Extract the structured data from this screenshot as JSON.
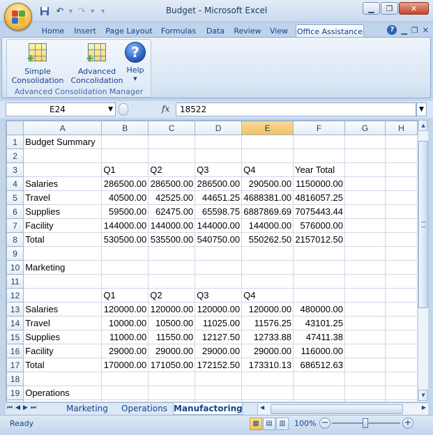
{
  "window": {
    "title": "Budget - Microsoft Excel"
  },
  "ribbon": {
    "tabs": [
      "Home",
      "Insert",
      "Page Layout",
      "Formulas",
      "Data",
      "Review",
      "View",
      "Office Assistance"
    ],
    "active_tab": "Office Assistance",
    "group": {
      "label": "Advanced Consolidation Manager",
      "buttons": [
        {
          "label1": "Simple",
          "label2": "Consolidation"
        },
        {
          "label1": "Advanced",
          "label2": "Concolidation"
        },
        {
          "label1": "Help",
          "label2": ""
        }
      ]
    }
  },
  "formula_bar": {
    "name_box": "E24",
    "fx": "fx",
    "value": "18522"
  },
  "sheet": {
    "columns": [
      "A",
      "B",
      "C",
      "D",
      "E",
      "F",
      "G",
      "H"
    ],
    "selected_column": "E",
    "rows": [
      [
        "Budget Summary",
        "",
        "",
        "",
        "",
        "",
        "",
        ""
      ],
      [
        "",
        "",
        "",
        "",
        "",
        "",
        "",
        ""
      ],
      [
        "",
        "Q1",
        "Q2",
        "Q3",
        "Q4",
        "Year Total",
        "",
        ""
      ],
      [
        "Salaries",
        "286500.00",
        "286500.00",
        "286500.00",
        "290500.00",
        "1150000.00",
        "",
        ""
      ],
      [
        "Travel",
        "40500.00",
        "42525.00",
        "44651.25",
        "4688381.00",
        "4816057.25",
        "",
        ""
      ],
      [
        "Supplies",
        "59500.00",
        "62475.00",
        "65598.75",
        "6887869.69",
        "7075443.44",
        "",
        ""
      ],
      [
        "Facility",
        "144000.00",
        "144000.00",
        "144000.00",
        "144000.00",
        "576000.00",
        "",
        ""
      ],
      [
        "Total",
        "530500.00",
        "535500.00",
        "540750.00",
        "550262.50",
        "2157012.50",
        "",
        ""
      ],
      [
        "",
        "",
        "",
        "",
        "",
        "",
        "",
        ""
      ],
      [
        "Marketing",
        "",
        "",
        "",
        "",
        "",
        "",
        ""
      ],
      [
        "",
        "",
        "",
        "",
        "",
        "",
        "",
        ""
      ],
      [
        "",
        "Q1",
        "Q2",
        "Q3",
        "Q4",
        "",
        "",
        ""
      ],
      [
        "Salaries",
        "120000.00",
        "120000.00",
        "120000.00",
        "120000.00",
        "480000.00",
        "",
        ""
      ],
      [
        "Travel",
        "10000.00",
        "10500.00",
        "11025.00",
        "11576.25",
        "43101.25",
        "",
        ""
      ],
      [
        "Supplies",
        "11000.00",
        "11550.00",
        "12127.50",
        "12733.88",
        "47411.38",
        "",
        ""
      ],
      [
        "Facility",
        "29000.00",
        "29000.00",
        "29000.00",
        "29000.00",
        "116000.00",
        "",
        ""
      ],
      [
        "Total",
        "170000.00",
        "171050.00",
        "172152.50",
        "173310.13",
        "686512.63",
        "",
        ""
      ],
      [
        "",
        "",
        "",
        "",
        "",
        "",
        "",
        ""
      ],
      [
        "Operations",
        "",
        "",
        "",
        "",
        "",
        "",
        ""
      ],
      [
        "",
        "",
        "",
        "",
        "",
        "",
        "",
        ""
      ]
    ]
  },
  "sheet_tabs": {
    "tabs": [
      "Marketing",
      "Operations",
      "Manufactoring"
    ],
    "active": "Manufactoring"
  },
  "status": {
    "ready": "Ready",
    "zoom": "100%"
  }
}
